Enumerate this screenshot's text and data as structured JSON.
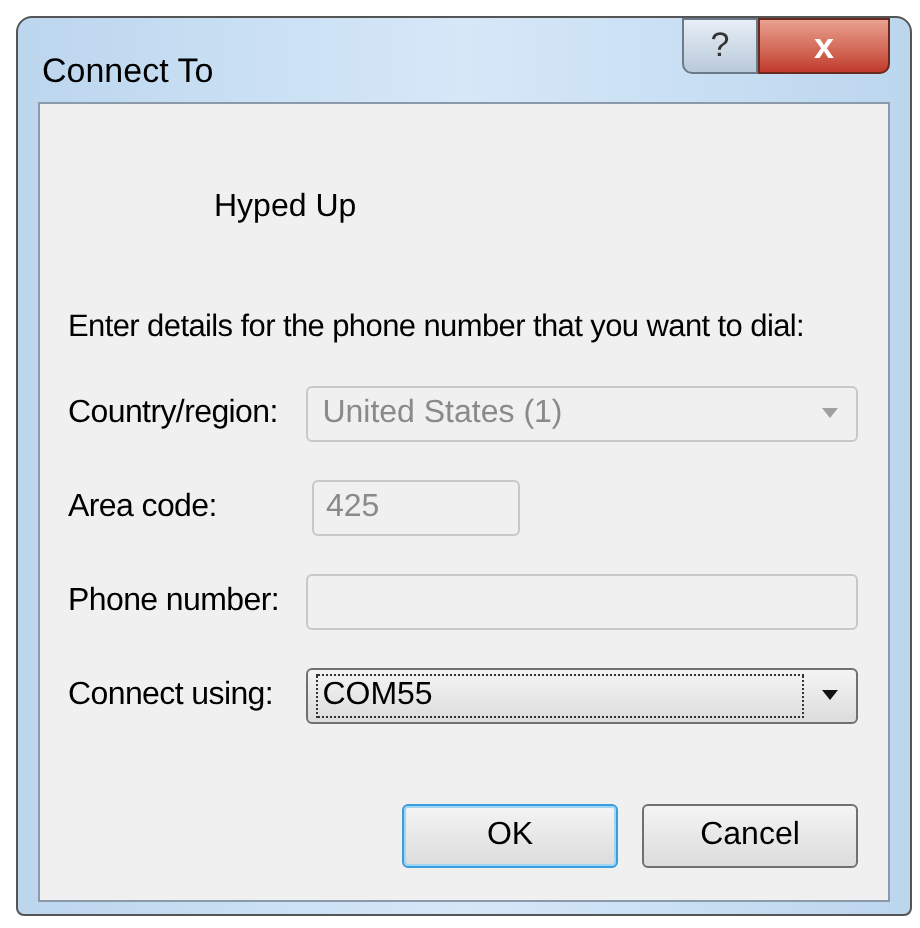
{
  "window": {
    "title": "Connect To",
    "help_button": "?",
    "close_button": "x"
  },
  "entry_name": "Hyped Up",
  "instruction": "Enter details for the phone number that you want to dial:",
  "fields": [
    {
      "label": "Country/region:",
      "kind": "dropdown",
      "value": "United States (1)",
      "disabled": true,
      "focused": false
    },
    {
      "label": "Area code:",
      "kind": "text",
      "value": "425",
      "disabled": true,
      "focused": false
    },
    {
      "label": "Phone number:",
      "kind": "text",
      "disabled": true,
      "focused": false
    },
    {
      "label": "Connect using:",
      "kind": "dropdown",
      "value": "COM55",
      "disabled": false,
      "focused": true
    }
  ],
  "buttons": [
    {
      "label": "OK",
      "default": true
    },
    {
      "label": "Cancel",
      "default": false
    }
  ]
}
